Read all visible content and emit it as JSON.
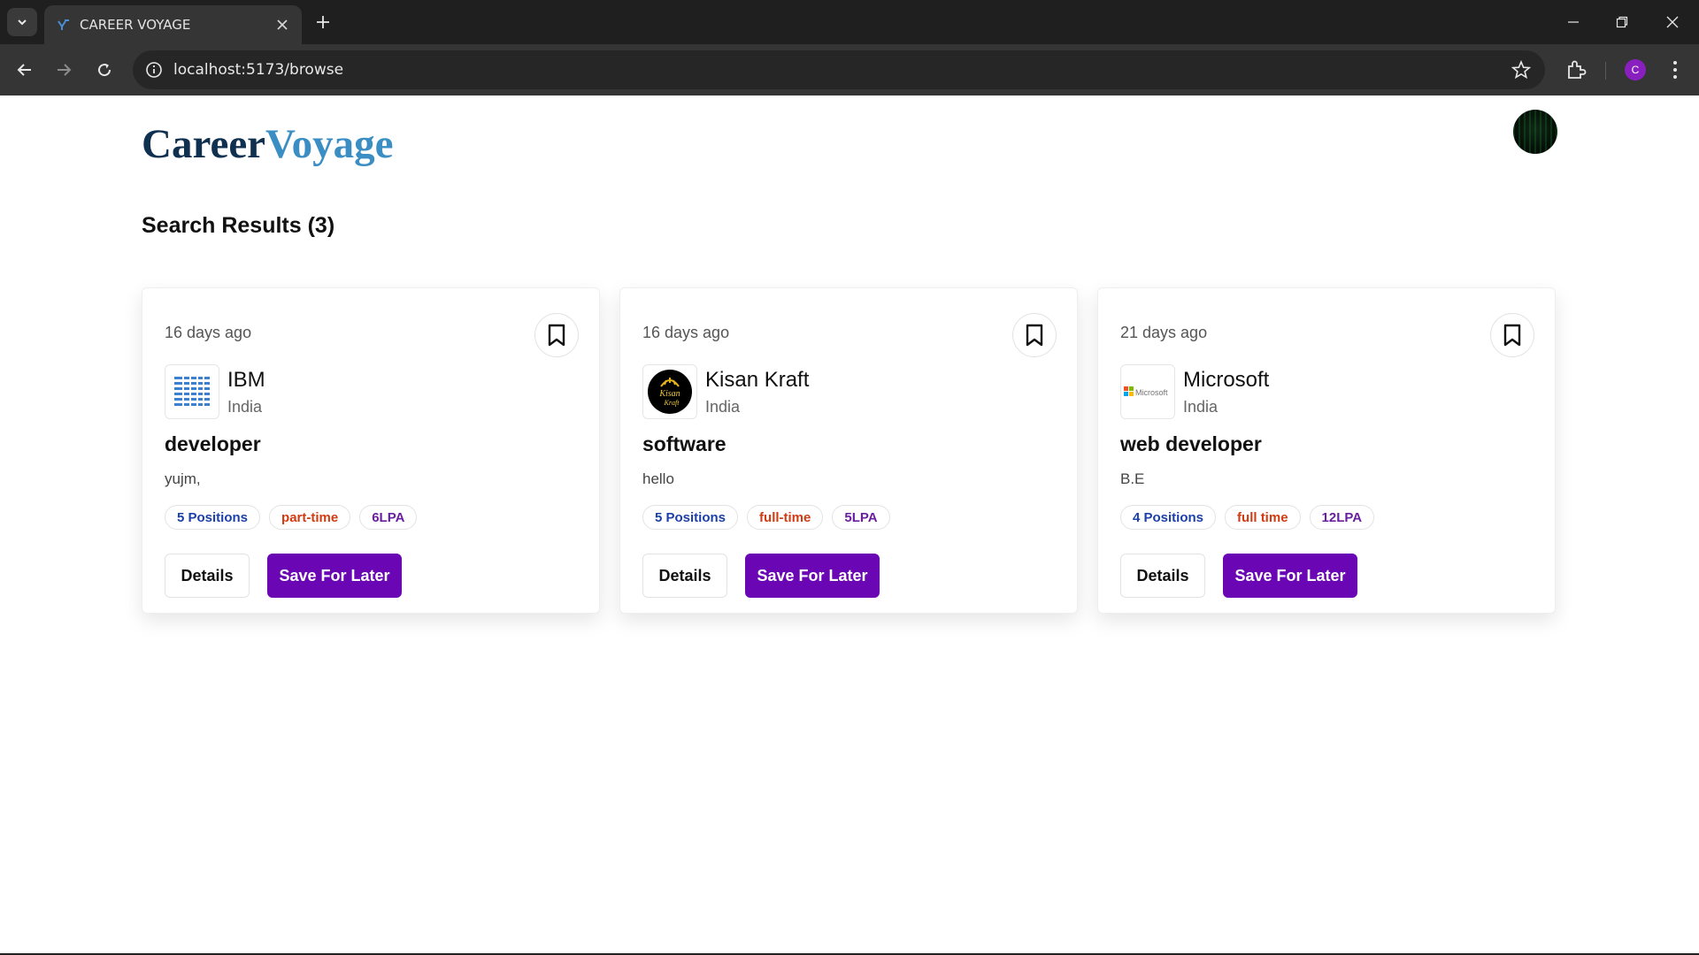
{
  "browser": {
    "tab_title": "CAREER VOYAGE",
    "url": "localhost:5173/browse",
    "profile_initial": "C"
  },
  "brand": {
    "part1": "Career",
    "part2": "Voyage"
  },
  "results": {
    "title": "Search Results (3)"
  },
  "jobs": [
    {
      "posted": "16 days ago",
      "company": "IBM",
      "location": "India",
      "title": "developer",
      "description": "yujm,",
      "positions": "5 Positions",
      "job_type": "part-time",
      "salary": "6LPA",
      "details_label": "Details",
      "save_label": "Save For Later",
      "logo_icon": "ibm-logo"
    },
    {
      "posted": "16 days ago",
      "company": "Kisan Kraft",
      "location": "India",
      "title": "software",
      "description": "hello",
      "positions": "5 Positions",
      "job_type": "full-time",
      "salary": "5LPA",
      "details_label": "Details",
      "save_label": "Save For Later",
      "logo_icon": "kisan-kraft-logo",
      "logo_text_1": "Kisan",
      "logo_text_2": "Kraft"
    },
    {
      "posted": "21 days ago",
      "company": "Microsoft",
      "location": "India",
      "title": "web developer",
      "description": "B.E",
      "positions": "4 Positions",
      "job_type": "full time",
      "salary": "12LPA",
      "details_label": "Details",
      "save_label": "Save For Later",
      "logo_icon": "microsoft-logo",
      "logo_text": "Microsoft"
    }
  ],
  "colors": {
    "brand_dark": "#10304f",
    "brand_light": "#3b8ec4",
    "primary_button": "#6a06b4",
    "badge_positions": "#1c3fa8",
    "badge_type": "#d13b12",
    "badge_salary": "#6a1fa0"
  }
}
